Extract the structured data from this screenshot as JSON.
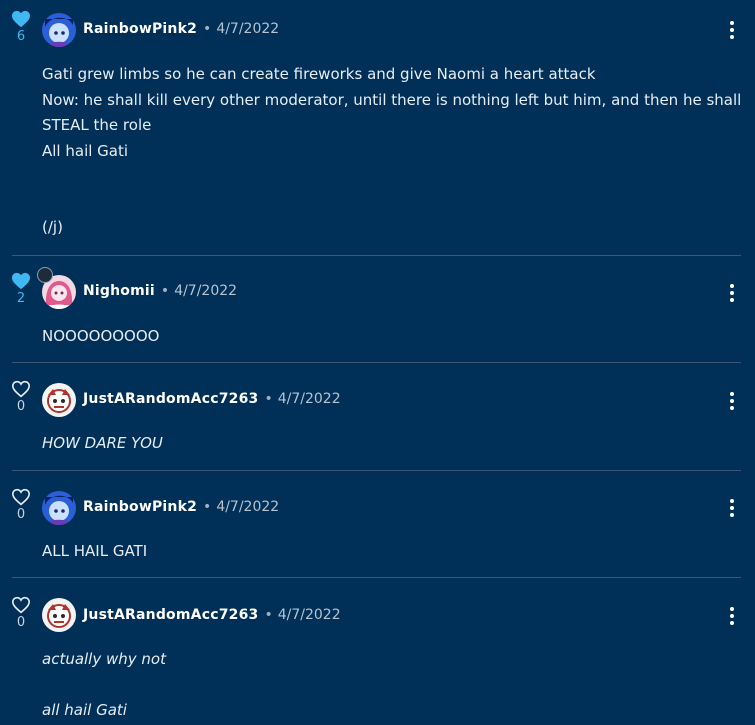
{
  "comments": [
    {
      "likes": "6",
      "liked": true,
      "username": "RainbowPink2",
      "separator": "•",
      "date": "4/7/2022",
      "lines": [
        "Gati grew limbs so he can create fireworks and give Naomi a heart attack",
        "Now: he shall kill every other moderator, until there is nothing left but him, and then he shall",
        "STEAL the role",
        "All hail Gati",
        "",
        "",
        "(/j)"
      ],
      "colors": {
        "avatar_bg": "#2a5fd8",
        "avatar_fg": "#c9e1ff"
      }
    },
    {
      "likes": "2",
      "liked": true,
      "username": "Nighomii",
      "separator": "•",
      "date": "4/7/2022",
      "lines": [
        "NOOOOOOOOO"
      ],
      "colors": {
        "avatar_bg": "#f2d9e4",
        "avatar_fg": "#e05a8c"
      }
    },
    {
      "likes": "0",
      "liked": false,
      "username": "JustARandomAcc7263",
      "separator": "•",
      "date": "4/7/2022",
      "lines": [
        "HOW DARE YOU"
      ],
      "colors": {
        "avatar_bg": "#f4f4f4",
        "avatar_fg": "#b0342c"
      }
    },
    {
      "likes": "0",
      "liked": false,
      "username": "RainbowPink2",
      "separator": "•",
      "date": "4/7/2022",
      "lines": [
        "ALL HAIL GATI"
      ],
      "colors": {
        "avatar_bg": "#2a5fd8",
        "avatar_fg": "#c9e1ff"
      }
    },
    {
      "likes": "0",
      "liked": false,
      "username": "JustARandomAcc7263",
      "separator": "•",
      "date": "4/7/2022",
      "lines": [
        "actually why not",
        "",
        "all hail Gati"
      ],
      "colors": {
        "avatar_bg": "#f4f4f4",
        "avatar_fg": "#b0342c"
      }
    }
  ],
  "icons": {
    "heart_filled": "heart-filled-icon",
    "heart_outline": "heart-outline-icon",
    "more": "more-vertical-icon"
  },
  "theme": {
    "background": "#002f57",
    "accent": "#3fb9f3",
    "divider": "#3c5674"
  }
}
